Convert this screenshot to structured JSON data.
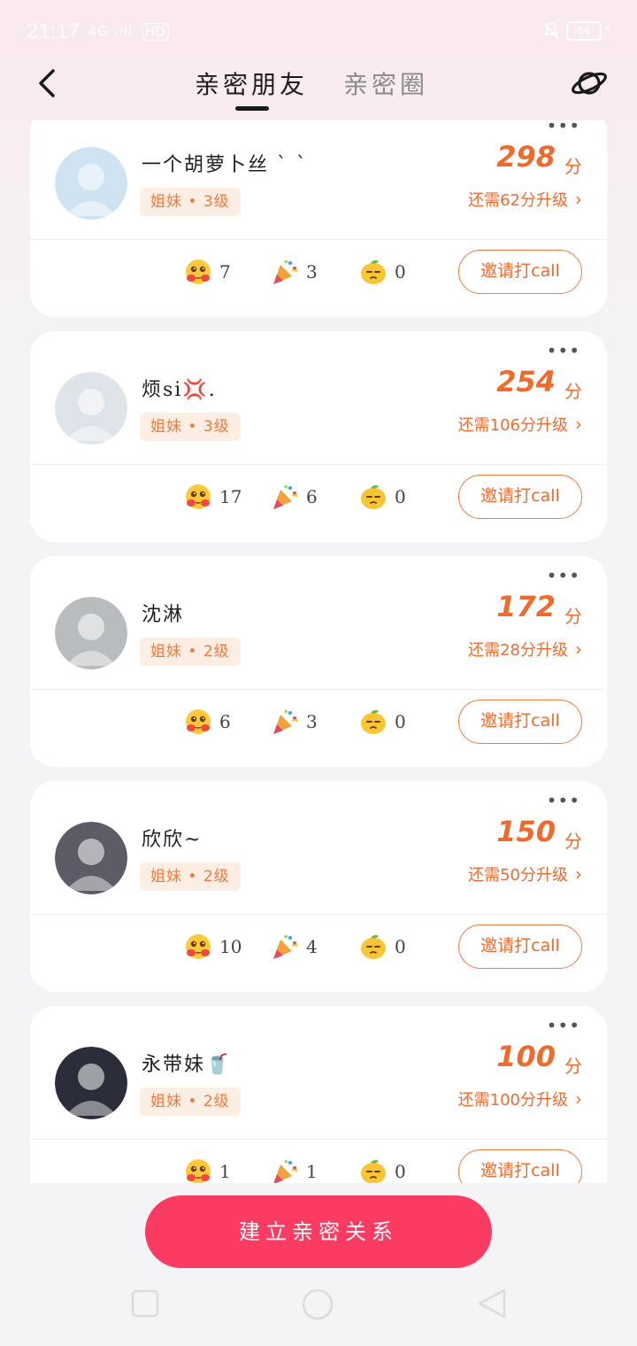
{
  "status_bar": {
    "time": "21:17",
    "signal": "4G .ıll",
    "hd": "HD",
    "battery": "56"
  },
  "header": {
    "tabs": [
      {
        "label": "亲密朋友",
        "active": true
      },
      {
        "label": "亲密圈",
        "active": false
      }
    ]
  },
  "friends": [
    {
      "name": "一个胡萝卜丝 ` ` ",
      "badge": "姐妹 • 3级",
      "score": "298",
      "score_unit": "分",
      "upgrade": "还需62分升级",
      "stats": [
        {
          "emoji": "hug",
          "count": "7"
        },
        {
          "emoji": "party-popper",
          "count": "3"
        },
        {
          "emoji": "lemon",
          "count": "0"
        }
      ],
      "call_label": "邀请打call",
      "avatar_color": "#cfe3f2"
    },
    {
      "name": "烦si💢.",
      "badge": "姐妹 • 3级",
      "score": "254",
      "score_unit": "分",
      "upgrade": "还需106分升级",
      "stats": [
        {
          "emoji": "hug",
          "count": "17"
        },
        {
          "emoji": "party-popper",
          "count": "6"
        },
        {
          "emoji": "lemon",
          "count": "0"
        }
      ],
      "call_label": "邀请打call",
      "avatar_color": "#dfe4ea"
    },
    {
      "name": "沈淋",
      "badge": "姐妹 • 2级",
      "score": "172",
      "score_unit": "分",
      "upgrade": "还需28分升级",
      "stats": [
        {
          "emoji": "hug",
          "count": "6"
        },
        {
          "emoji": "party-popper",
          "count": "3"
        },
        {
          "emoji": "lemon",
          "count": "0"
        }
      ],
      "call_label": "邀请打call",
      "avatar_color": "#b9bcbe"
    },
    {
      "name": "欣欣~",
      "badge": "姐妹 • 2级",
      "score": "150",
      "score_unit": "分",
      "upgrade": "还需50分升级",
      "stats": [
        {
          "emoji": "hug",
          "count": "10"
        },
        {
          "emoji": "party-popper",
          "count": "4"
        },
        {
          "emoji": "lemon",
          "count": "0"
        }
      ],
      "call_label": "邀请打call",
      "avatar_color": "#5e5a66"
    },
    {
      "name": "永带妹🥤",
      "badge": "姐妹 • 2级",
      "score": "100",
      "score_unit": "分",
      "upgrade": "还需100分升级",
      "stats": [
        {
          "emoji": "hug",
          "count": "1"
        },
        {
          "emoji": "party-popper",
          "count": "1"
        },
        {
          "emoji": "lemon",
          "count": "0"
        }
      ],
      "call_label": "邀请打call",
      "avatar_color": "#2b2d3a"
    }
  ],
  "more_label": "•••",
  "bottom": {
    "build_label": "建立亲密关系"
  },
  "colors": {
    "accent": "#ee6b2e",
    "primary_button": "#fb3b61",
    "badge_bg": "#fdeee4"
  }
}
